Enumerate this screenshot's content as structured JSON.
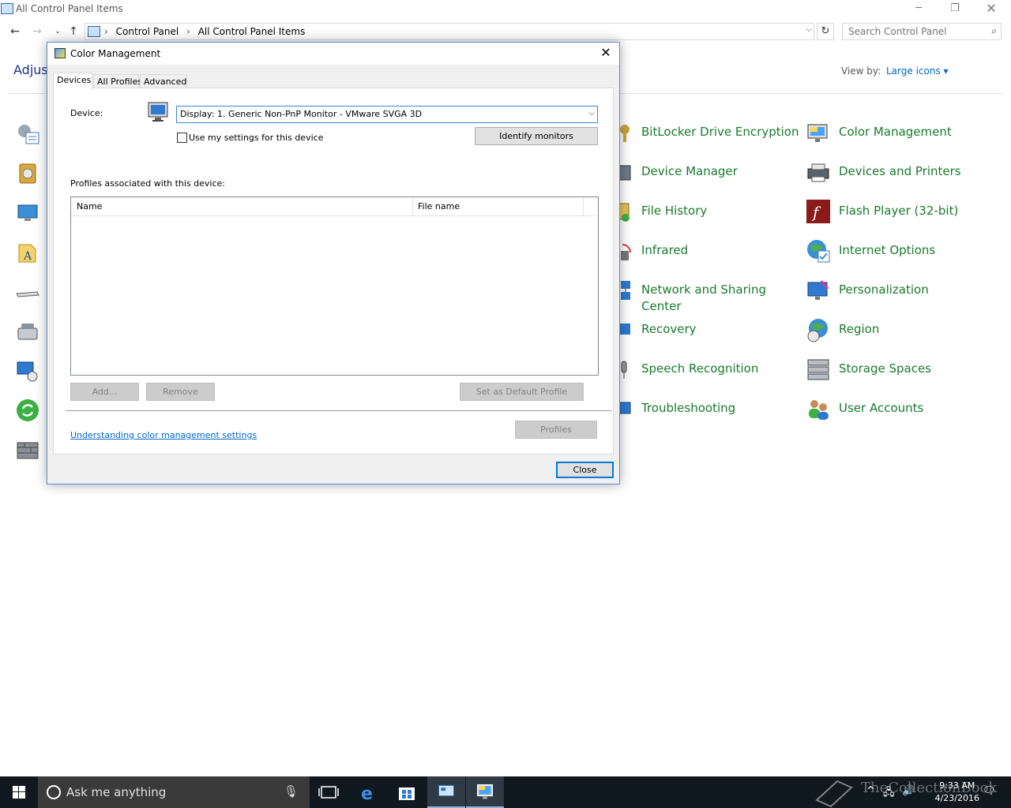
{
  "explorer": {
    "title": "All Control Panel Items",
    "breadcrumbs": [
      "Control Panel",
      "All Control Panel Items"
    ],
    "search_placeholder": "Search Control Panel",
    "heading_fragment": "Adjust",
    "view_by_label": "View by:",
    "view_by_value": "Large icons ▾"
  },
  "items": [
    {
      "label": "BitLocker Drive Encryption",
      "icon": "bitlocker-icon"
    },
    {
      "label": "Color Management",
      "icon": "color-management-icon"
    },
    {
      "label": "Device Manager",
      "icon": "device-manager-icon"
    },
    {
      "label": "Devices and Printers",
      "icon": "printer-icon"
    },
    {
      "label": "File History",
      "icon": "file-history-icon"
    },
    {
      "label": "Flash Player (32-bit)",
      "icon": "flash-icon"
    },
    {
      "label": "Infrared",
      "icon": "infrared-icon"
    },
    {
      "label": "Internet Options",
      "icon": "internet-options-icon"
    },
    {
      "label": "Network and Sharing Center",
      "icon": "network-icon"
    },
    {
      "label": "Personalization",
      "icon": "personalization-icon"
    },
    {
      "label": "Recovery",
      "icon": "recovery-icon"
    },
    {
      "label": "Region",
      "icon": "region-icon"
    },
    {
      "label": "Speech Recognition",
      "icon": "speech-icon"
    },
    {
      "label": "Storage Spaces",
      "icon": "storage-spaces-icon"
    },
    {
      "label": "Troubleshooting",
      "icon": "troubleshooting-icon"
    },
    {
      "label": "User Accounts",
      "icon": "user-accounts-icon"
    }
  ],
  "dialog": {
    "title": "Color Management",
    "tabs": [
      "Devices",
      "All Profiles",
      "Advanced"
    ],
    "device_label": "Device:",
    "device_value": "Display: 1. Generic Non-PnP Monitor - VMware SVGA 3D",
    "use_settings_label": "Use my settings for this device",
    "identify_button": "Identify monitors",
    "profiles_label": "Profiles associated with this device:",
    "columns": [
      "Name",
      "File name"
    ],
    "add_button": "Add...",
    "remove_button": "Remove",
    "set_default_button": "Set as Default Profile",
    "link": "Understanding color management settings",
    "profiles_button": "Profiles",
    "close_button": "Close"
  },
  "taskbar": {
    "search_text": "Ask me anything",
    "time": "9:33 AM",
    "date": "4/23/2016",
    "watermark": "TheCollectionBook"
  }
}
